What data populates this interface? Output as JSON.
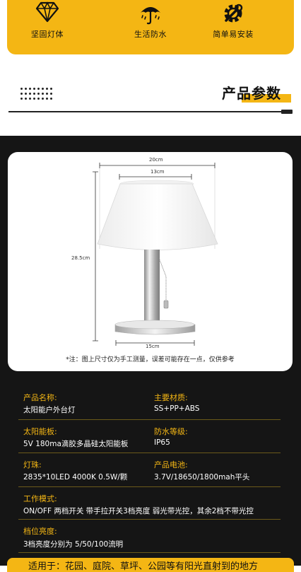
{
  "features": [
    {
      "label": "坚固灯体",
      "icon": "diamond-icon"
    },
    {
      "label": "生活防水",
      "icon": "umbrella-rain-icon"
    },
    {
      "label": "简单易安装",
      "icon": "gear-wrench-icon"
    }
  ],
  "section_title": "产品参数",
  "dimensions": {
    "width": "20cm",
    "shade_top": "13cm",
    "height": "28.5cm",
    "base": "15cm"
  },
  "note": "*注：图上尺寸仅为手工测量，误差可能存在一点，仅供参考",
  "specs": {
    "name_label": "产品名称:",
    "name_value": "太阳能户外台灯",
    "material_label": "主要材质:",
    "material_value": "SS+PP+ABS",
    "panel_label": "太阳能板:",
    "panel_value": "5V 180ma滴胶多晶硅太阳能板",
    "waterproof_label": "防水等级:",
    "waterproof_value": "IP65",
    "bead_label": "灯珠:",
    "bead_value": "2835*10LED 4000K 0.5W/颗",
    "battery_label": "产品电池:",
    "battery_value": "3.7V/18650/1800mah平头",
    "mode_label": "工作模式:",
    "mode_value": "ON/OFF 两档开关 带手拉开关3档亮度 弱光带光控，其余2档不带光控",
    "brightness_label": "档位亮度:",
    "brightness_value": "3档亮度分别为 5/50/100流明"
  },
  "bottom_text": "适用于：花园、庭院、草坪、公园等有阳光直射到的地方",
  "colors": {
    "accent": "#f4b614",
    "dark": "#151515"
  }
}
